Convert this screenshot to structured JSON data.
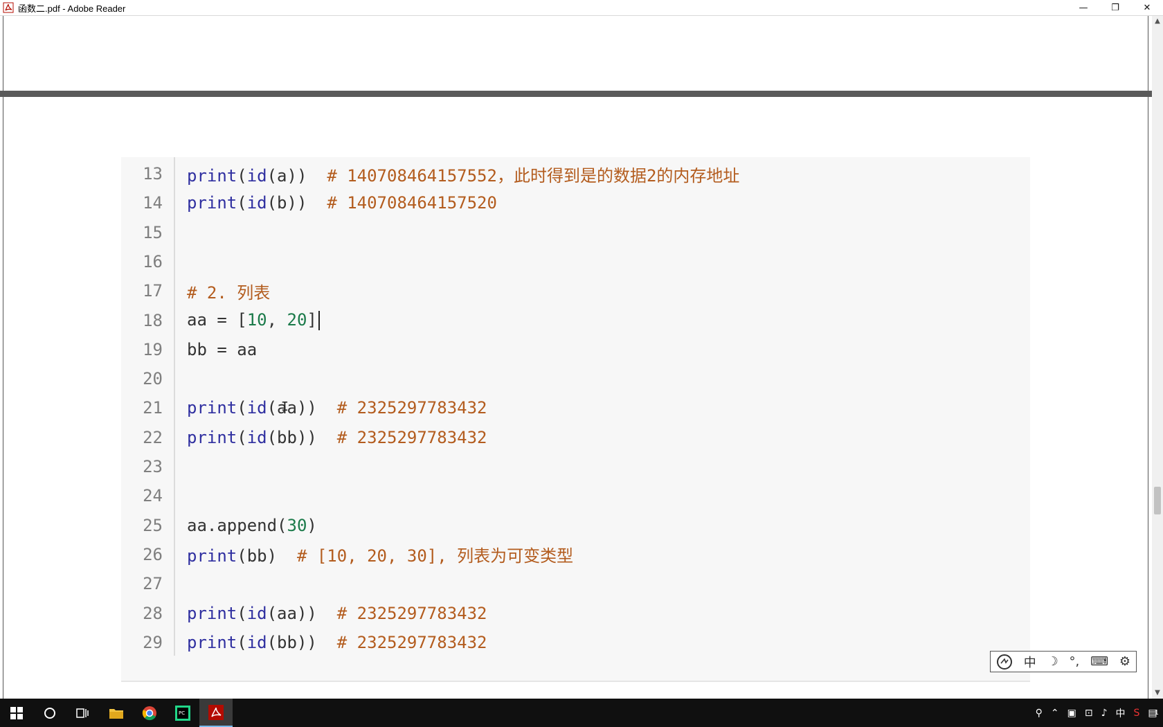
{
  "window": {
    "title": "函数二.pdf - Adobe Reader",
    "minimize": "—",
    "restore": "❐",
    "close": "✕"
  },
  "code": {
    "lines": [
      {
        "n": "13",
        "parts": [
          [
            "kw",
            "print"
          ],
          [
            "p",
            "("
          ],
          [
            "kw",
            "id"
          ],
          [
            "p",
            "(a))  "
          ],
          [
            "cm",
            "# 140708464157552，此时得到是的数据2的内存地址"
          ]
        ]
      },
      {
        "n": "14",
        "parts": [
          [
            "kw",
            "print"
          ],
          [
            "p",
            "("
          ],
          [
            "kw",
            "id"
          ],
          [
            "p",
            "(b))  "
          ],
          [
            "cm",
            "# 140708464157520"
          ]
        ]
      },
      {
        "n": "15",
        "parts": []
      },
      {
        "n": "16",
        "parts": []
      },
      {
        "n": "17",
        "parts": [
          [
            "cm",
            "# 2. 列表"
          ]
        ]
      },
      {
        "n": "18",
        "parts": [
          [
            "p",
            "aa = ["
          ],
          [
            "num",
            "10"
          ],
          [
            "p",
            ", "
          ],
          [
            "num",
            "20"
          ],
          [
            "p",
            "]"
          ],
          [
            "caret",
            ""
          ]
        ]
      },
      {
        "n": "19",
        "parts": [
          [
            "p",
            "bb = aa"
          ]
        ]
      },
      {
        "n": "20",
        "parts": []
      },
      {
        "n": "21",
        "parts": [
          [
            "kw",
            "print"
          ],
          [
            "p",
            "("
          ],
          [
            "kw",
            "id"
          ],
          [
            "p",
            "(aa))  "
          ],
          [
            "cm",
            "# 2325297783432"
          ]
        ]
      },
      {
        "n": "22",
        "parts": [
          [
            "kw",
            "print"
          ],
          [
            "p",
            "("
          ],
          [
            "kw",
            "id"
          ],
          [
            "p",
            "(bb))  "
          ],
          [
            "cm",
            "# 2325297783432"
          ]
        ]
      },
      {
        "n": "23",
        "parts": []
      },
      {
        "n": "24",
        "parts": []
      },
      {
        "n": "25",
        "parts": [
          [
            "p",
            "aa.append("
          ],
          [
            "num",
            "30"
          ],
          [
            "p",
            ")"
          ]
        ]
      },
      {
        "n": "26",
        "parts": [
          [
            "kw",
            "print"
          ],
          [
            "p",
            "(bb)  "
          ],
          [
            "cm",
            "# [10, 20, 30], 列表为可变类型"
          ]
        ]
      },
      {
        "n": "27",
        "parts": []
      },
      {
        "n": "28",
        "parts": [
          [
            "kw",
            "print"
          ],
          [
            "p",
            "("
          ],
          [
            "kw",
            "id"
          ],
          [
            "p",
            "(aa))  "
          ],
          [
            "cm",
            "# 2325297783432"
          ]
        ]
      },
      {
        "n": "29",
        "parts": [
          [
            "kw",
            "print"
          ],
          [
            "p",
            "("
          ],
          [
            "kw",
            "id"
          ],
          [
            "p",
            "(bb))  "
          ],
          [
            "cm",
            "# 2325297783432"
          ]
        ]
      }
    ]
  },
  "ime": {
    "lang": "中",
    "moon": "☽",
    "punct": "°,",
    "keyboard": "⌨",
    "settings": "⚙"
  },
  "taskbar": {
    "tray_ime": "中",
    "notif": "1"
  },
  "colors": {
    "keyword": "#2f2fa0",
    "number": "#1b7a4a",
    "comment": "#b35c1e",
    "text": "#333333"
  }
}
